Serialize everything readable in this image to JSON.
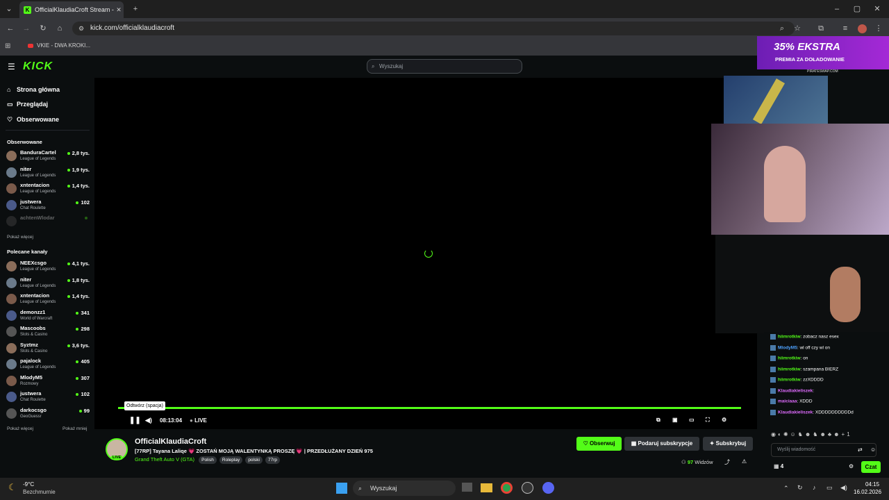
{
  "browser": {
    "tab_title": "OfficialKlaudiaCroft Stream - W",
    "url": "kick.com/officialklaudiacroft",
    "bookmark": "VKIE - DWA KROKI..."
  },
  "header": {
    "logo": "KICK",
    "search_placeholder": "Wyszukaj"
  },
  "sidebar": {
    "nav": [
      {
        "label": "Strona główna",
        "icon": "home-icon"
      },
      {
        "label": "Przeglądaj",
        "icon": "browse-icon"
      },
      {
        "label": "Obserwowane",
        "icon": "heart-icon"
      }
    ],
    "followed_title": "Obserwowane",
    "followed": [
      {
        "name": "BanduraCartel",
        "category": "League of Legends",
        "viewers": "2,8 tys."
      },
      {
        "name": "niter",
        "category": "League of Legends",
        "viewers": "1,9 tys."
      },
      {
        "name": "xntentacion",
        "category": "League of Legends",
        "viewers": "1,4 tys."
      },
      {
        "name": "justwera",
        "category": "Chat Roulette",
        "viewers": "102"
      },
      {
        "name": "achtenWlodar",
        "category": "",
        "viewers": ""
      }
    ],
    "followed_more": "Pokaż więcej",
    "recommended_title": "Polecane kanały",
    "recommended": [
      {
        "name": "NEEXcsgo",
        "category": "League of Legends",
        "viewers": "4,1 tys."
      },
      {
        "name": "niter",
        "category": "League of Legends",
        "viewers": "1,8 tys."
      },
      {
        "name": "xntentacion",
        "category": "League of Legends",
        "viewers": "1,4 tys."
      },
      {
        "name": "demonzz1",
        "category": "World of Warcraft",
        "viewers": "341"
      },
      {
        "name": "Mascoobs",
        "category": "Slots & Casino",
        "viewers": "298"
      },
      {
        "name": "Syztmz",
        "category": "Slots & Casino",
        "viewers": "3,6 tys."
      },
      {
        "name": "pajalock",
        "category": "League of Legends",
        "viewers": "405"
      },
      {
        "name": "MlodyM5",
        "category": "Rozmowy",
        "viewers": "307"
      },
      {
        "name": "justwera",
        "category": "Chat Roulette",
        "viewers": "102"
      },
      {
        "name": "darkocsgo",
        "category": "GeoGuessr",
        "viewers": "99"
      }
    ],
    "show_more": "Pokaż więcej",
    "show_less": "Pokaż mniej"
  },
  "player": {
    "tooltip": "Odtwórz (spacja)",
    "time": "08:13:04",
    "live": "LIVE",
    "progress": 1.0
  },
  "stream": {
    "channel": "OfficialKlaudiaCroft",
    "live_badge": "LIVE",
    "title": "[77RP] Tayana Laliqe 💗 ZOSTAŃ MOJĄ WALENTYNKĄ PROSZĘ 💗 | PRZEDŁUŻANY DZIEŃ 975",
    "category": "Grand Theft Auto V (GTA)",
    "tags": [
      "Polish",
      "Roleplay",
      "polski",
      "77rp"
    ],
    "follow": "Obserwuj",
    "gift": "Podaruj subskrypcje",
    "subscribe": "Subskrybuj",
    "viewers": "97",
    "viewers_label": "Widzów"
  },
  "ad": {
    "headline": "35% EKSTRA",
    "sub": "PREMIA ZA DOŁADOWANIE",
    "brand": "PIRATESWAP.COM"
  },
  "chat": {
    "messages": [
      {
        "user": "hiimrotkiw",
        "text": "zobacz nasz esex"
      },
      {
        "user": "MlodyM5",
        "text": "wl off czy wl on"
      },
      {
        "user": "hiimrotkiw",
        "text": "on"
      },
      {
        "user": "hiimrotkiw",
        "text": "szampana BIERZ"
      },
      {
        "user": "hiimrotkiw",
        "text": "zzXDDDD"
      },
      {
        "user": "Klaudiakieliszek",
        "text": ""
      },
      {
        "user": "maiciaaa",
        "text": "XDDD"
      },
      {
        "user": "Klaudiakieliszek",
        "text": "XDDDDDDDDDDd"
      }
    ],
    "emote_count": "+1",
    "input_placeholder": "Wyślij wiadomość",
    "users": "4",
    "send": "Czat"
  },
  "taskbar": {
    "weather_temp": "-9°C",
    "weather_desc": "Bezchmurnie",
    "search": "Wyszukaj",
    "time": "04:15",
    "date": "16.02.2026"
  },
  "colors": {
    "accent": "#53fc18",
    "bg": "#0b0e0f"
  }
}
